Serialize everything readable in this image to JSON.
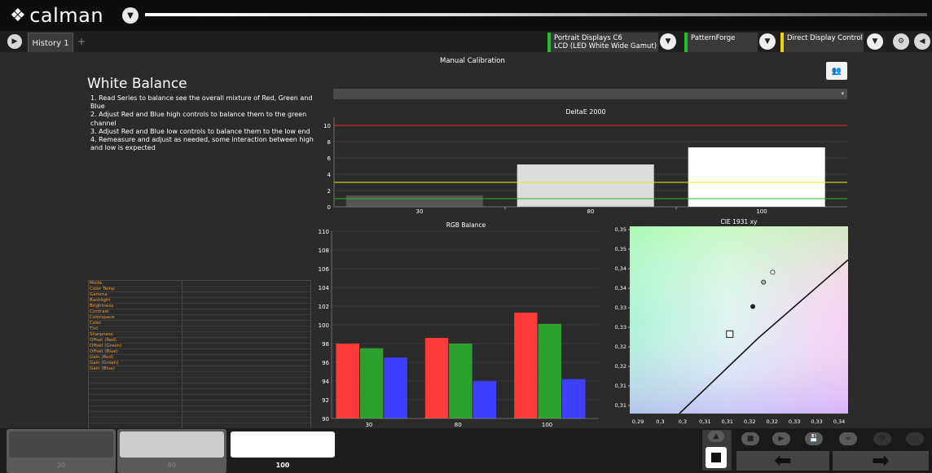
{
  "app": {
    "logo_text": "calman",
    "history_tab": "History 1",
    "add_tab": "+"
  },
  "devices": [
    {
      "line1": "Portrait Displays C6",
      "line2": "LCD (LED White Wide Gamut)",
      "accent": "#22c02a"
    },
    {
      "line1": "PatternForge",
      "line2": "",
      "accent": "#22c02a"
    },
    {
      "line1": "Direct Display Control",
      "line2": "",
      "accent": "#e8d21a"
    }
  ],
  "page": {
    "title": "Manual Calibration",
    "heading": "White Balance",
    "instructions": [
      "1. Read Series to balance see the overall mixture of Red, Green and Blue",
      "2. Adjust Red and Blue high controls to balance them to the green channel",
      "3. Adjust Red and Blue low controls to balance them to the low end",
      "4. Remeasure and adjust as needed, some interaction between high and low is expected"
    ],
    "series_select_arrow": "▾"
  },
  "readings_table": {
    "rows": [
      "Mode",
      "Color Temp",
      "Gamma",
      "Backlight",
      "Brightness",
      "Contrast",
      "Colorspace",
      "Color",
      "Tint",
      "Sharpness",
      "Offset (Red)",
      "Offset (Green)",
      "Offset (Blue)",
      "Gain (Red)",
      "Gain (Green)",
      "Gain (Blue)"
    ],
    "label_color": "#e8a13c"
  },
  "chart_data": [
    {
      "type": "bar",
      "title": "DeltaE 2000",
      "categories": [
        "30",
        "80",
        "100"
      ],
      "values": [
        1.4,
        5.2,
        7.3
      ],
      "ylim": [
        0,
        11
      ],
      "yticks": [
        0,
        2,
        4,
        6,
        8,
        10
      ],
      "thresholds": [
        {
          "value": 10,
          "color": "#ff2a2a"
        },
        {
          "value": 3,
          "color": "#e8e81a"
        },
        {
          "value": 1,
          "color": "#2bb52b"
        }
      ],
      "grid": true
    },
    {
      "type": "bar",
      "title": "RGB Balance",
      "categories": [
        "30",
        "80",
        "100"
      ],
      "series": [
        {
          "color": "#ff3a3a",
          "values": [
            98.0,
            98.6,
            101.3
          ]
        },
        {
          "color": "#2ea02e",
          "values": [
            97.5,
            98.0,
            100.1
          ]
        },
        {
          "color": "#3f3fff",
          "values": [
            96.5,
            94.0,
            94.2
          ]
        }
      ],
      "ylim": [
        90,
        110
      ],
      "yticks": [
        90,
        92,
        94,
        96,
        98,
        100,
        102,
        104,
        106,
        108,
        110
      ],
      "grid": true
    },
    {
      "type": "scatter",
      "title": "CIE 1931 xy",
      "xticks": [
        "0,29",
        "0,3",
        "0,3",
        "0,31",
        "0,31",
        "0,32",
        "0,32",
        "0,33",
        "0,33",
        "0,34"
      ],
      "yticks": [
        "0,31",
        "0,31",
        "0,32",
        "0,32",
        "0,33",
        "0,33",
        "0,34",
        "0,34",
        "0,35",
        "0,35"
      ],
      "xlim": [
        0.2875,
        0.3425
      ],
      "ylim": [
        0.3065,
        0.3595
      ],
      "target": {
        "x": 0.3127,
        "y": 0.329
      },
      "points": [
        {
          "x": 0.3185,
          "y": 0.3368,
          "fill": "#222222"
        },
        {
          "x": 0.3212,
          "y": 0.3437,
          "fill": "#aaaaaa"
        },
        {
          "x": 0.3235,
          "y": 0.3465,
          "fill": "#ffffff"
        }
      ],
      "planckian_locus": [
        [
          0.3,
          0.3065
        ],
        [
          0.32,
          0.328
        ],
        [
          0.3425,
          0.35
        ]
      ]
    }
  ],
  "swatches": [
    {
      "label": "30",
      "color": "#474747",
      "active": false
    },
    {
      "label": "80",
      "color": "#cccccc",
      "active": false
    },
    {
      "label": "100",
      "color": "#ffffff",
      "active": true
    }
  ],
  "controls": {
    "up": "▲",
    "stop": "■",
    "play": "▶",
    "save": "💾",
    "loop": "∞",
    "refresh": "⟳",
    "prev": "⬅",
    "next": "➡"
  }
}
